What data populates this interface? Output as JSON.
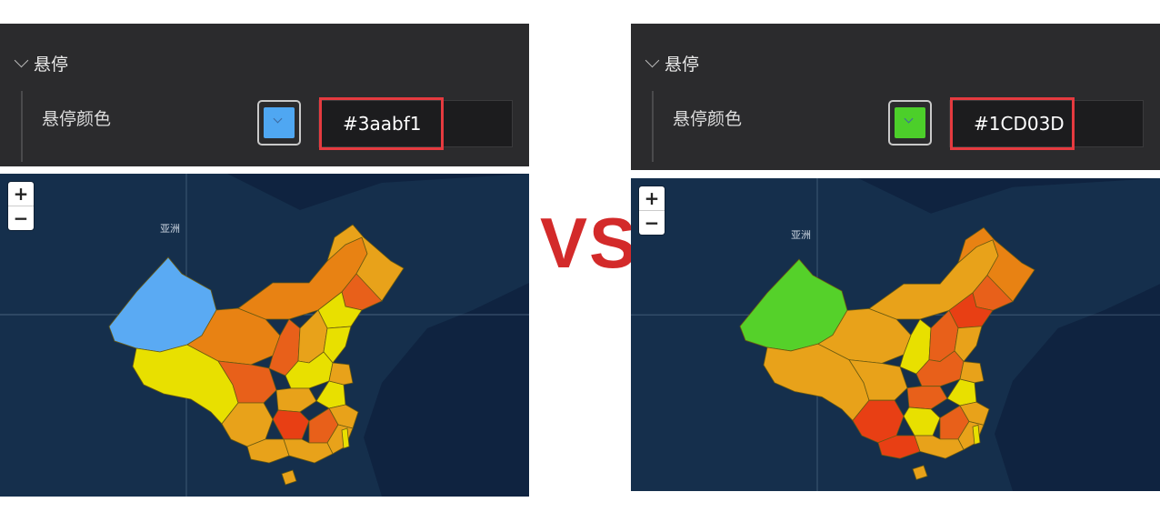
{
  "vs_label": "VS",
  "panels": {
    "left": {
      "section_title": "悬停",
      "property_label": "悬停颜色",
      "hover_color_value": "#3aabf1",
      "swatch_color": "#4fa7f2",
      "map": {
        "zoom_in": "+",
        "zoom_out": "−",
        "region_label": "亚洲",
        "highlighted_region_color": "#5aaaf3"
      }
    },
    "right": {
      "section_title": "悬停",
      "property_label": "悬停颜色",
      "hover_color_value": "#1CD03D",
      "swatch_color": "#4ccf2a",
      "map": {
        "zoom_in": "+",
        "zoom_out": "−",
        "region_label": "亚洲",
        "highlighted_region_color": "#55d12a"
      }
    }
  },
  "colors": {
    "panel_bg": "#2b2b2d",
    "highlight_border": "#e53a3f",
    "map_ocean": "#0f2340",
    "map_land": "#1b3a55",
    "vs_color": "#d32a2a",
    "choropleth": [
      "#e8e000",
      "#e8a21a",
      "#e88213",
      "#e8601a",
      "#e83f14"
    ]
  }
}
